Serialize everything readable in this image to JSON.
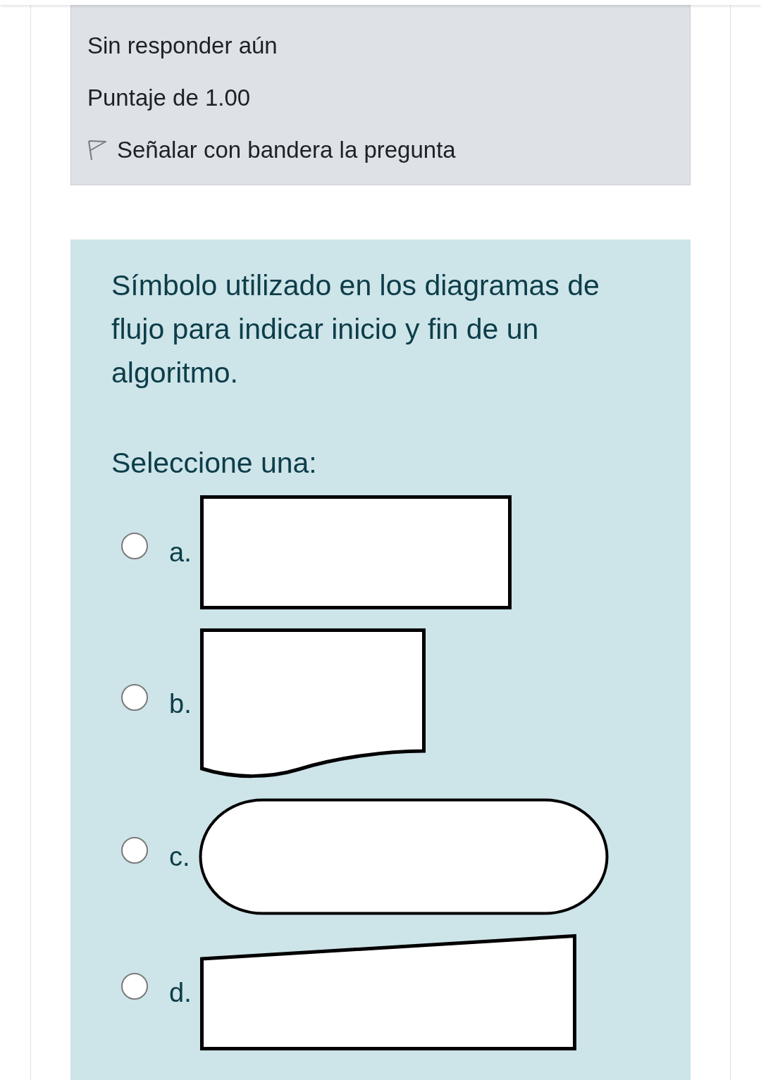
{
  "info": {
    "status": "Sin responder aún",
    "grade": "Puntaje de 1.00",
    "flag": {
      "label": "Señalar con bandera la pregunta",
      "flagged": false
    }
  },
  "question": {
    "text": "Símbolo utilizado en los diagramas de flujo para indicar inicio y fin de un algoritmo.",
    "prompt": "Seleccione una:",
    "options": [
      {
        "letter": "a.",
        "kind": "rectangle",
        "selected": false
      },
      {
        "letter": "b.",
        "kind": "document",
        "selected": false
      },
      {
        "letter": "c.",
        "kind": "terminal",
        "selected": false
      },
      {
        "letter": "d.",
        "kind": "manual_input",
        "selected": false
      }
    ]
  }
}
